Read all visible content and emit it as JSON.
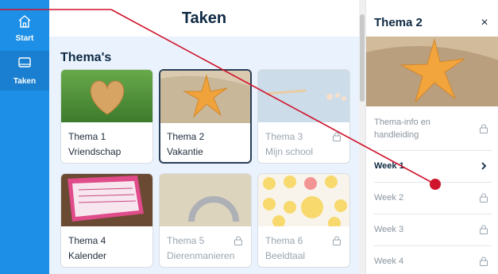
{
  "sidebar": {
    "items": [
      {
        "label": "Start",
        "icon": "home-icon"
      },
      {
        "label": "Taken",
        "icon": "tasks-icon"
      }
    ]
  },
  "main": {
    "title": "Taken",
    "section_title": "Thema's",
    "cards": [
      {
        "title": "Thema 1",
        "subtitle": "Vriendschap",
        "locked": false
      },
      {
        "title": "Thema 2",
        "subtitle": "Vakantie",
        "locked": false,
        "selected": true
      },
      {
        "title": "Thema 3",
        "subtitle": "Mijn school",
        "locked": true
      },
      {
        "title": "Thema 4",
        "subtitle": "Kalender",
        "locked": false
      },
      {
        "title": "Thema 5",
        "subtitle": "Dierenmanieren",
        "locked": true
      },
      {
        "title": "Thema 6",
        "subtitle": "Beeldtaal",
        "locked": true
      }
    ]
  },
  "panel": {
    "title": "Thema 2",
    "close": "×",
    "items": [
      {
        "label": "Thema-info en handleiding",
        "icon": "lock-icon"
      },
      {
        "label": "Week 1",
        "icon": "chevron-right-icon",
        "active": true
      },
      {
        "label": "Week 2",
        "icon": "lock-icon"
      },
      {
        "label": "Week 3",
        "icon": "lock-icon"
      },
      {
        "label": "Week 4",
        "icon": "lock-icon"
      }
    ]
  },
  "colors": {
    "sidebar": "#1d8fe6",
    "accent_line": "#d0142c",
    "title": "#0f2a44"
  }
}
